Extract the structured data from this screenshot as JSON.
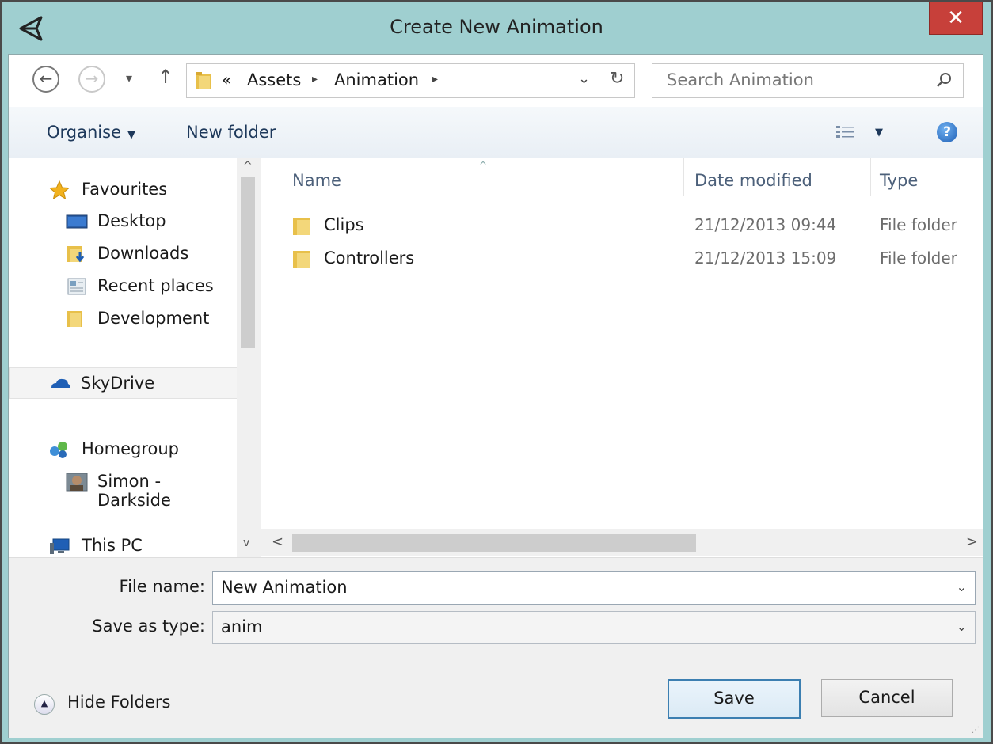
{
  "window": {
    "title": "Create New Animation",
    "close_label": "✕"
  },
  "nav": {
    "back_label": "←",
    "forward_label": "→",
    "recent_label": "▾",
    "up_label": "↑",
    "breadcrumb": {
      "overflow": "«",
      "items": [
        "Assets",
        "Animation"
      ],
      "separator": "▸"
    },
    "dropdown_label": "⌄",
    "refresh_label": "↻",
    "search_placeholder": "Search Animation"
  },
  "toolbar": {
    "organise_label": "Organise",
    "organise_arrow": "▼",
    "new_folder_label": "New folder",
    "view_dd_label": "▼",
    "help_label": "?"
  },
  "navpane": {
    "items": [
      {
        "label": "Favourites",
        "icon": "star-icon"
      },
      {
        "label": "Desktop",
        "icon": "desktop-icon"
      },
      {
        "label": "Downloads",
        "icon": "downloads-icon"
      },
      {
        "label": "Recent places",
        "icon": "recent-places-icon"
      },
      {
        "label": "Development",
        "icon": "folder-icon"
      },
      {
        "label": "SkyDrive",
        "icon": "skydrive-icon"
      },
      {
        "label": "Homegroup",
        "icon": "homegroup-icon"
      },
      {
        "label": "Simon - Darkside",
        "icon": "user-avatar-icon"
      },
      {
        "label": "This PC",
        "icon": "this-pc-icon"
      }
    ],
    "scroll_up": "^",
    "scroll_down": "v"
  },
  "files": {
    "columns": [
      "Name",
      "Date modified",
      "Type"
    ],
    "sort_indicator": "^",
    "rows": [
      {
        "name": "Clips",
        "date": "21/12/2013 09:44",
        "type": "File folder"
      },
      {
        "name": "Controllers",
        "date": "21/12/2013 15:09",
        "type": "File folder"
      }
    ],
    "hscroll_left": "<",
    "hscroll_right": ">"
  },
  "form": {
    "file_name_label": "File name:",
    "file_name_value": "New Animation",
    "save_type_label": "Save as type:",
    "save_type_value": "anim",
    "dropdown_glyph": "⌄"
  },
  "footer": {
    "hide_folders_label": "Hide Folders",
    "hide_folders_glyph": "▲",
    "save_label": "Save",
    "cancel_label": "Cancel",
    "grip": "⋰"
  },
  "colors": {
    "window_frame": "#9fcfd0",
    "close_red": "#c7403a",
    "folder_yellow": "#e8c04a",
    "toolbar_text": "#1e395b"
  }
}
